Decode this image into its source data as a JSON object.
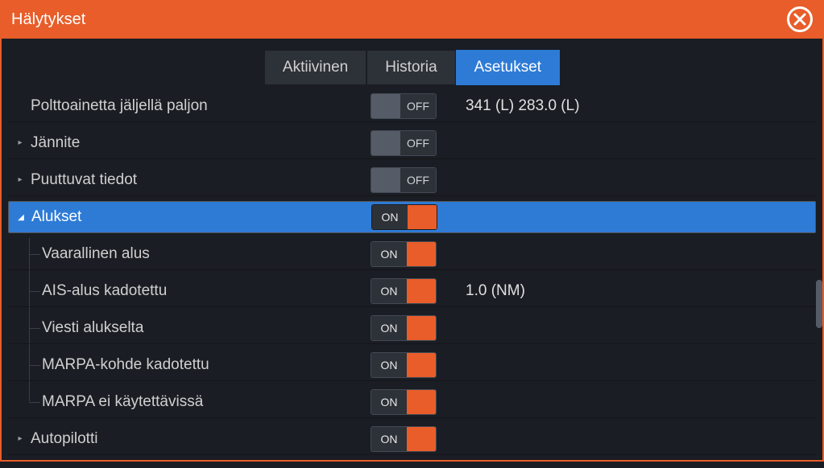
{
  "title": "Hälytykset",
  "tabs": {
    "active": "Aktiivinen",
    "history": "Historia",
    "settings": "Asetukset"
  },
  "toggle_labels": {
    "on": "ON",
    "off": "OFF"
  },
  "rows": {
    "fuel": {
      "label": "Polttoainetta jäljellä paljon",
      "value": "341 (L)  283.0 (L)"
    },
    "voltage": {
      "label": "Jännite"
    },
    "missing": {
      "label": "Puuttuvat tiedot"
    },
    "vessels": {
      "label": "Alukset"
    },
    "dangerous": {
      "label": "Vaarallinen alus"
    },
    "ais_lost": {
      "label": "AIS-alus kadotettu",
      "value": "1.0 (NM)"
    },
    "msg_vessel": {
      "label": "Viesti alukselta"
    },
    "marpa_lost": {
      "label": "MARPA-kohde kadotettu"
    },
    "marpa_unavail": {
      "label": "MARPA ei käytettävissä"
    },
    "autopilot": {
      "label": "Autopilotti"
    }
  }
}
